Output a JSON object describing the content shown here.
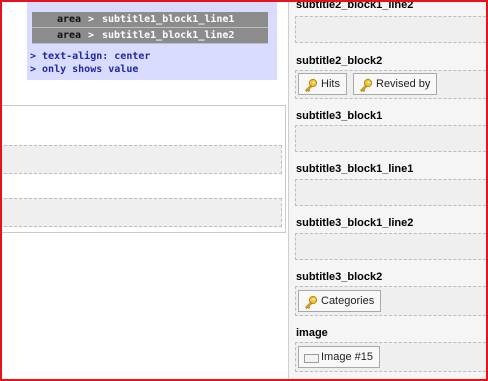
{
  "left_panel": {
    "area_rows": [
      {
        "label": "area",
        "sep": ">",
        "value": "subtitle1_block1_line1"
      },
      {
        "label": "area",
        "sep": ">",
        "value": "subtitle1_block1_line2"
      }
    ],
    "notes": [
      "> text-align: center",
      "> only shows value"
    ]
  },
  "right_panel": {
    "sections": [
      {
        "label": "subtitle2_block1_line2"
      },
      {
        "label": "subtitle2_block2",
        "fields": [
          "Hits",
          "Revised by"
        ]
      },
      {
        "label": "subtitle3_block1"
      },
      {
        "label": "subtitle3_block1_line1"
      },
      {
        "label": "subtitle3_block1_line2"
      },
      {
        "label": "subtitle3_block2",
        "fields": [
          "Categories"
        ]
      },
      {
        "label": "image",
        "fields": [
          "Image #15"
        ]
      }
    ]
  },
  "colors": {
    "frame_border": "#e8121a",
    "panel_bg": "#d9dbff",
    "area_row_bg": "#8c8c8c",
    "note_text": "#1f2aa0"
  }
}
